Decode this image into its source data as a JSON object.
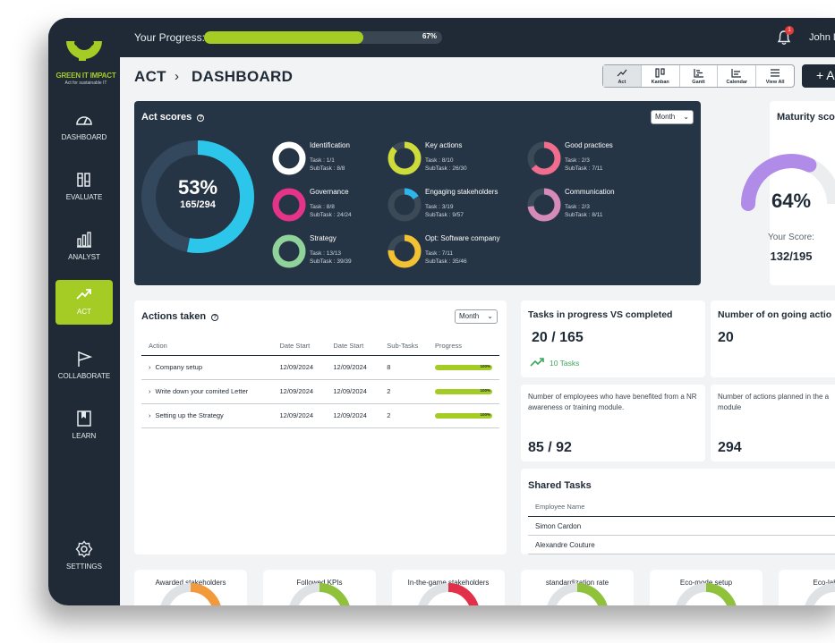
{
  "topbar": {
    "progress_label": "Your Progress:",
    "progress_pct": "67%",
    "progress_value": 0.67,
    "notifications": "1",
    "user": "John D"
  },
  "logo": {
    "title": "GREEN IT IMPACT",
    "subtitle": "Act for sustainable IT"
  },
  "sidebar": {
    "items": [
      {
        "label": "DASHBOARD",
        "icon": "gauge-icon"
      },
      {
        "label": "EVALUATE",
        "icon": "clipboard-icon"
      },
      {
        "label": "ANALYST",
        "icon": "bar-chart-icon"
      },
      {
        "label": "ACT",
        "icon": "trend-up-icon",
        "active": true
      },
      {
        "label": "COLLABORATE",
        "icon": "flag-icon"
      },
      {
        "label": "LEARN",
        "icon": "book-icon"
      },
      {
        "label": "SETTINGS",
        "icon": "gear-icon"
      }
    ]
  },
  "breadcrumb": {
    "section": "ACT",
    "page": "DASHBOARD"
  },
  "views": [
    "Act",
    "Kanban",
    "Gantt",
    "Calendar",
    "View All"
  ],
  "add_label": "+ A",
  "act_scores": {
    "title": "Act scores",
    "period": "Month",
    "pct": "53%",
    "pct_value": 0.53,
    "ratio": "165/294",
    "items": [
      {
        "name": "Identification",
        "task": "Task : 1/1",
        "subtask": "SubTask : 8/8",
        "color": "#ffffff",
        "fill": 1.0
      },
      {
        "name": "Governance",
        "task": "Task : 8/8",
        "subtask": "SubTask : 24/24",
        "color": "#e6338a",
        "fill": 1.0
      },
      {
        "name": "Strategy",
        "task": "Task : 13/13",
        "subtask": "SubTask : 39/39",
        "color": "#8fd39a",
        "fill": 1.0
      },
      {
        "name": "Key actions",
        "task": "Task : 8/10",
        "subtask": "SubTask : 26/30",
        "color": "#cddc3a",
        "fill": 0.87
      },
      {
        "name": "Engaging stakeholders",
        "task": "Task : 3/19",
        "subtask": "SubTask : 9/57",
        "color": "#2fb6e8",
        "fill": 0.16
      },
      {
        "name": "Opt: Software company",
        "task": "Task : 7/11",
        "subtask": "SubTask : 35/46",
        "color": "#f2c233",
        "fill": 0.76
      },
      {
        "name": "Good practices",
        "task": "Task : 2/3",
        "subtask": "SubTask : 7/11",
        "color": "#f06d8e",
        "fill": 0.64
      },
      {
        "name": "Communication",
        "task": "Task : 2/3",
        "subtask": "SubTask : 8/11",
        "color": "#d58ab8",
        "fill": 0.73
      }
    ]
  },
  "maturity": {
    "title": "Maturity score",
    "pct": "64%",
    "pct_value": 0.64,
    "score_label": "Your Score:",
    "score": "132/195"
  },
  "actions_taken": {
    "title": "Actions taken",
    "period": "Month",
    "columns": [
      "Action",
      "Date Start",
      "Date Start",
      "Sub-Tasks",
      "Progress"
    ],
    "rows": [
      {
        "action": "Company setup",
        "d1": "12/09/2024",
        "d2": "12/09/2024",
        "sub": "8",
        "progress": "100%"
      },
      {
        "action": "Write down your comited Letter",
        "d1": "12/09/2024",
        "d2": "12/09/2024",
        "sub": "2",
        "progress": "100%"
      },
      {
        "action": "Setting up the Strategy",
        "d1": "12/09/2024",
        "d2": "12/09/2024",
        "sub": "2",
        "progress": "100%"
      }
    ]
  },
  "tasks_progress": {
    "title": "Tasks in progress VS completed",
    "value": "20 / 165",
    "trend": "10 Tasks"
  },
  "ongoing": {
    "title": "Number of on going actio",
    "value": "20"
  },
  "employees": {
    "desc": "Number of employees who have benefited from a NR awareness or training module.",
    "value": "85 / 92"
  },
  "planned": {
    "desc": "Number of actions planned in the a module",
    "value": "294"
  },
  "shared_tasks": {
    "title": "Shared Tasks",
    "column": "Employee Name",
    "rows": [
      "Simon Cardon",
      "Alexandre Couture"
    ]
  },
  "kpis": [
    "Awarded stakeholders",
    "Followed KPIs",
    "In-the-game stakeholders",
    "standardization rate",
    "Eco-mode setup",
    "Eco-label equ"
  ],
  "colors": {
    "dark": "#1f2a36",
    "accent": "#a4cc25",
    "cyan": "#2cc6ea",
    "purple": "#b18be8"
  }
}
